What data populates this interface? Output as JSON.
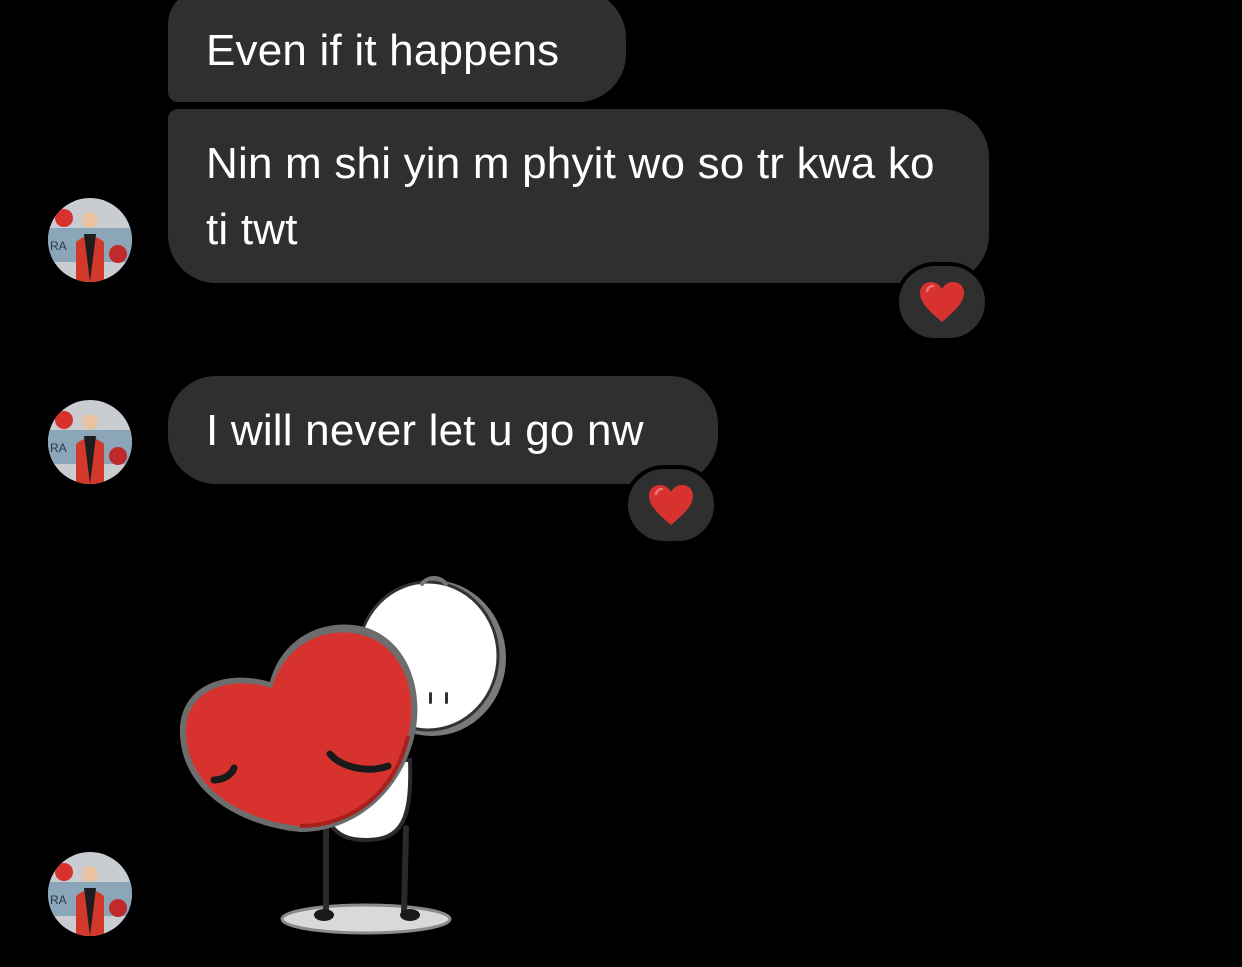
{
  "messages": [
    {
      "text": "Even if it happens",
      "reaction": null
    },
    {
      "text": "Nin m shi yin m phyit wo so tr kwa ko ti twt",
      "reaction": "red-heart"
    },
    {
      "text": "I will never let u go nw",
      "reaction": "red-heart"
    }
  ],
  "sticker": {
    "icon": "heart-hug-sticker"
  },
  "colors": {
    "background": "#000000",
    "bubble": "#2f2f2f",
    "text": "#ffffff",
    "heart": "#d8322f"
  }
}
